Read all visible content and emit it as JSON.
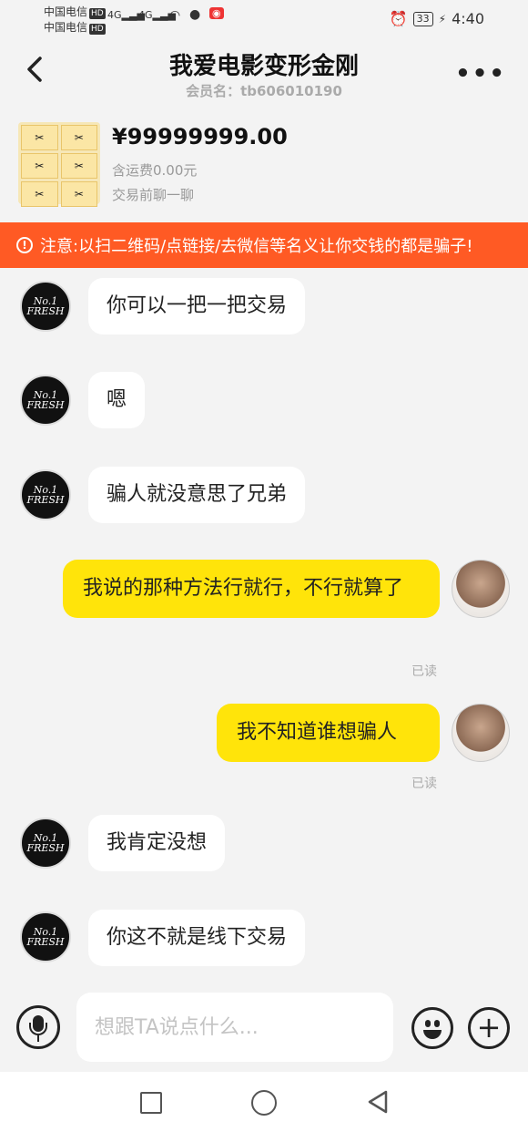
{
  "status_bar": {
    "carrier1": "中国电信",
    "carrier2": "中国电信",
    "hd": "HD",
    "network1": "4G",
    "network2": "4G",
    "battery": "33",
    "time": "4:40"
  },
  "header": {
    "title": "我爱电影变形金刚",
    "member_label": "会员名：tb606010190",
    "more": "•••"
  },
  "product": {
    "price": "¥99999999.00",
    "shipping": "含运费0.00元",
    "pre_chat": "交易前聊一聊",
    "thumb_tiles": [
      "✂",
      "✂",
      "✂",
      "✂",
      "✂",
      "✂"
    ]
  },
  "warning": {
    "icon": "!",
    "text": "注意:以扫二维码/点链接/去微信等名义让你交钱的都是骗子!"
  },
  "avatar_text": "No.1 FRESH",
  "messages": [
    {
      "from": "other",
      "text": "你可以一把一把交易"
    },
    {
      "from": "other",
      "text": "嗯"
    },
    {
      "from": "other",
      "text": "骗人就没意思了兄弟"
    },
    {
      "from": "me",
      "text": "我说的那种方法行就行，不行就算了",
      "status": "已读"
    },
    {
      "from": "me",
      "text": "我不知道谁想骗人",
      "status": "已读"
    },
    {
      "from": "other",
      "text": "我肯定没想"
    },
    {
      "from": "other",
      "text": "你这不就是线下交易"
    }
  ],
  "input": {
    "placeholder": "想跟TA说点什么...",
    "add": "+"
  },
  "colors": {
    "accent": "#ffe40a",
    "warning": "#ff5a24",
    "background": "#f3f3f3"
  }
}
